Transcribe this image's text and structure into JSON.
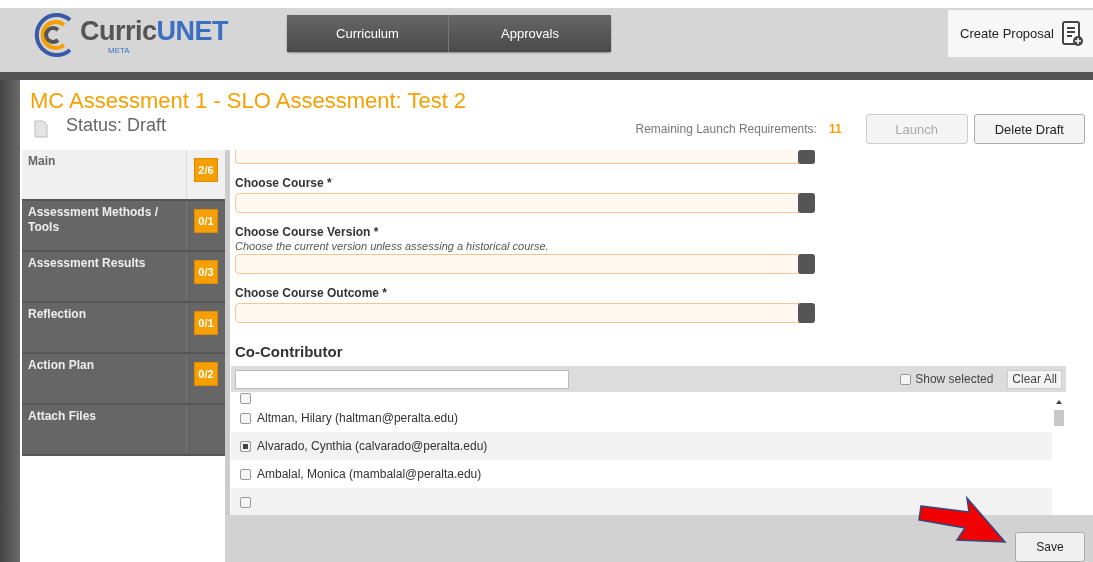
{
  "header": {
    "logo": {
      "text_1": "Curric",
      "text_2": "UNET",
      "tagline": "META"
    },
    "nav": [
      {
        "label": "Curriculum",
        "selected": false
      },
      {
        "label": "Approvals",
        "selected": false
      }
    ],
    "create_button": "Create Proposal"
  },
  "proposal": {
    "title": "MC Assessment 1 - SLO Assessment: Test 2",
    "status": "Status: Draft",
    "requirements_label": "Remaining Launch Requirements:",
    "requirements_count": "11",
    "buttons": [
      {
        "label": "Launch",
        "disabled": true
      },
      {
        "label": "Delete Draft",
        "disabled": false
      }
    ]
  },
  "sidebar": {
    "items": [
      {
        "label": "Main",
        "badge": "2/6",
        "selected": true
      },
      {
        "label": "Assessment Methods / Tools",
        "badge": "0/1",
        "selected": false
      },
      {
        "label": "Assessment Results",
        "badge": "0/3",
        "selected": false
      },
      {
        "label": "Reflection",
        "badge": "0/1",
        "selected": false
      },
      {
        "label": "Action Plan",
        "badge": "0/2",
        "selected": false
      },
      {
        "label": "Attach Files",
        "selected": false
      }
    ]
  },
  "form": {
    "fields": [
      {
        "label": "Choose Course *"
      },
      {
        "label": "Choose Course Version *",
        "hint": "Choose the current version unless assessing a historical course."
      },
      {
        "label": "Choose Course Outcome *"
      }
    ]
  },
  "co_contributor": {
    "heading": "Co-Contributor",
    "show_selected": {
      "label": "Show selected",
      "checked": false
    },
    "clear_button": "Clear All",
    "rows": [
      {
        "checked": false
      },
      {
        "label": "Altman, Hilary (haltman@peralta.edu)",
        "checked": false
      },
      {
        "label": "Alvarado, Cynthia (calvarado@peralta.edu)",
        "checked": true
      },
      {
        "label": "Ambalal, Monica (mambalal@peralta.edu)",
        "checked": false
      },
      {
        "checked": false
      }
    ]
  },
  "footer": {
    "save_button": "Save"
  }
}
